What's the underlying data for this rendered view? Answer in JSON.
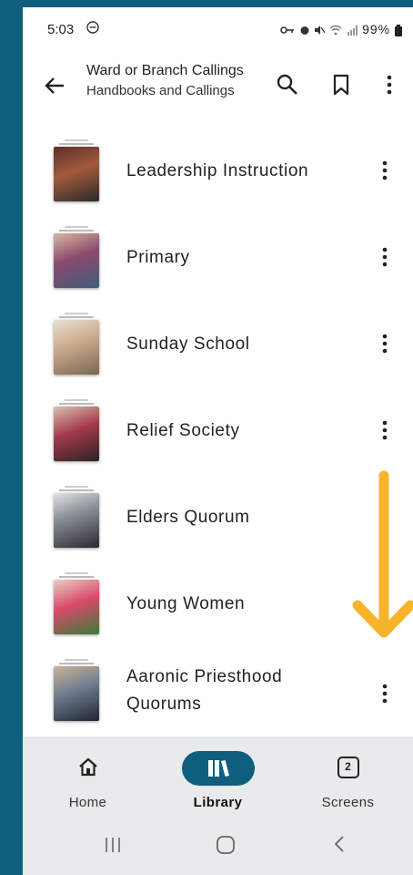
{
  "status": {
    "time": "5:03",
    "battery": "99%"
  },
  "header": {
    "title": "Ward or Branch Callings",
    "subtitle": "Handbooks and Callings"
  },
  "items": [
    {
      "label": "Leadership Instruction",
      "colors": [
        "#5a2f27",
        "#a35a3d",
        "#2a2a2a"
      ]
    },
    {
      "label": "Primary",
      "colors": [
        "#8b4a6e",
        "#d8b8a0",
        "#3f5d7a"
      ]
    },
    {
      "label": "Sunday School",
      "colors": [
        "#caa98a",
        "#7a6655",
        "#e8e0d6"
      ]
    },
    {
      "label": "Relief Society",
      "colors": [
        "#a43a4a",
        "#2b2224",
        "#d9c2b0"
      ]
    },
    {
      "label": "Elders Quorum",
      "colors": [
        "#e3e3e3",
        "#2a2a30",
        "#8a8f96"
      ]
    },
    {
      "label": "Young Women",
      "colors": [
        "#3d7a3a",
        "#d84a6b",
        "#e8d0c0"
      ]
    },
    {
      "label": "Aaronic Priesthood Quorums",
      "label_line1": "Aaronic Priesthood",
      "label_line2": "Quorums",
      "colors": [
        "#c9b39a",
        "#1f2530",
        "#6f7c8f"
      ]
    }
  ],
  "nav": {
    "home": "Home",
    "library": "Library",
    "screens": "Screens",
    "screens_count": "2"
  },
  "accent": "#0f5e7d",
  "arrow_color": "#f7b32b"
}
